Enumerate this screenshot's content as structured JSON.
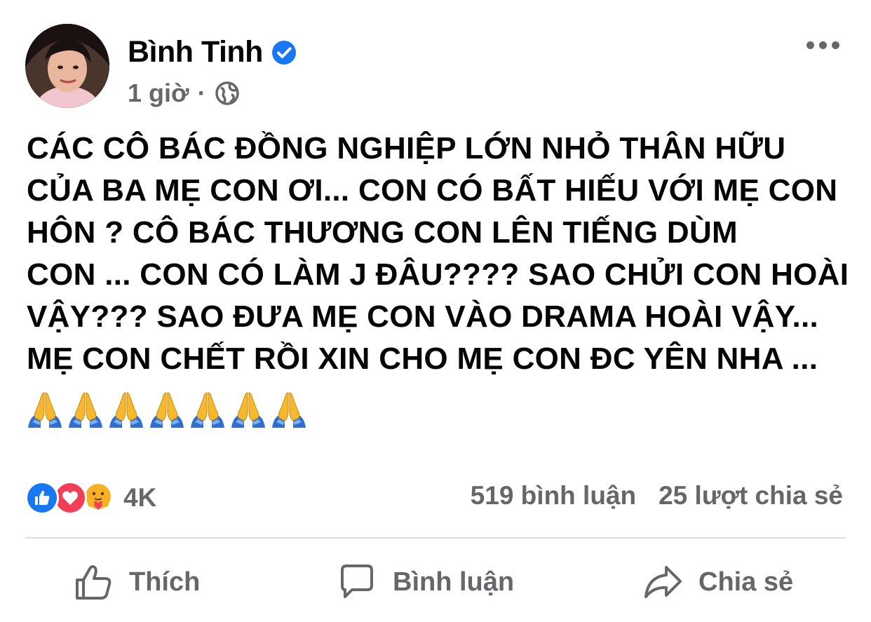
{
  "post": {
    "author": "Bình Tinh",
    "time": "1 giờ",
    "separator": "·",
    "text": "CÁC CÔ BÁC ĐỒNG NGHIỆP LỚN NHỎ THÂN HỮU\nCỦA BA MẸ CON ƠI... CON CÓ BẤT HIẾU VỚI MẸ CON\nHÔN ? CÔ BÁC THƯƠNG CON LÊN TIẾNG DÙM\nCON ... CON CÓ LÀM J ĐÂU???? SAO CHỬI CON HOÀI\nVẬY??? SAO ĐƯA MẸ CON VÀO DRAMA HOÀI VẬY...\nMẸ CON CHẾT RỒI XIN CHO MẸ CON ĐC YÊN NHA ...",
    "emoji_count": 7,
    "emoji_icon": "folded-hands-emoji"
  },
  "reactions": {
    "icons": [
      "like-reaction-icon",
      "love-reaction-icon",
      "care-reaction-icon"
    ],
    "count": "4K"
  },
  "stats": {
    "comments": "519 bình luận",
    "shares": "25 lượt chia sẻ"
  },
  "actions": {
    "like": "Thích",
    "comment": "Bình luận",
    "share": "Chia sẻ"
  },
  "colors": {
    "verified": "#1877f2",
    "like": "#1877f2",
    "love": "#f33e58",
    "care": "#f7b125",
    "muted_text": "#65676b",
    "divider": "#dadde1"
  }
}
